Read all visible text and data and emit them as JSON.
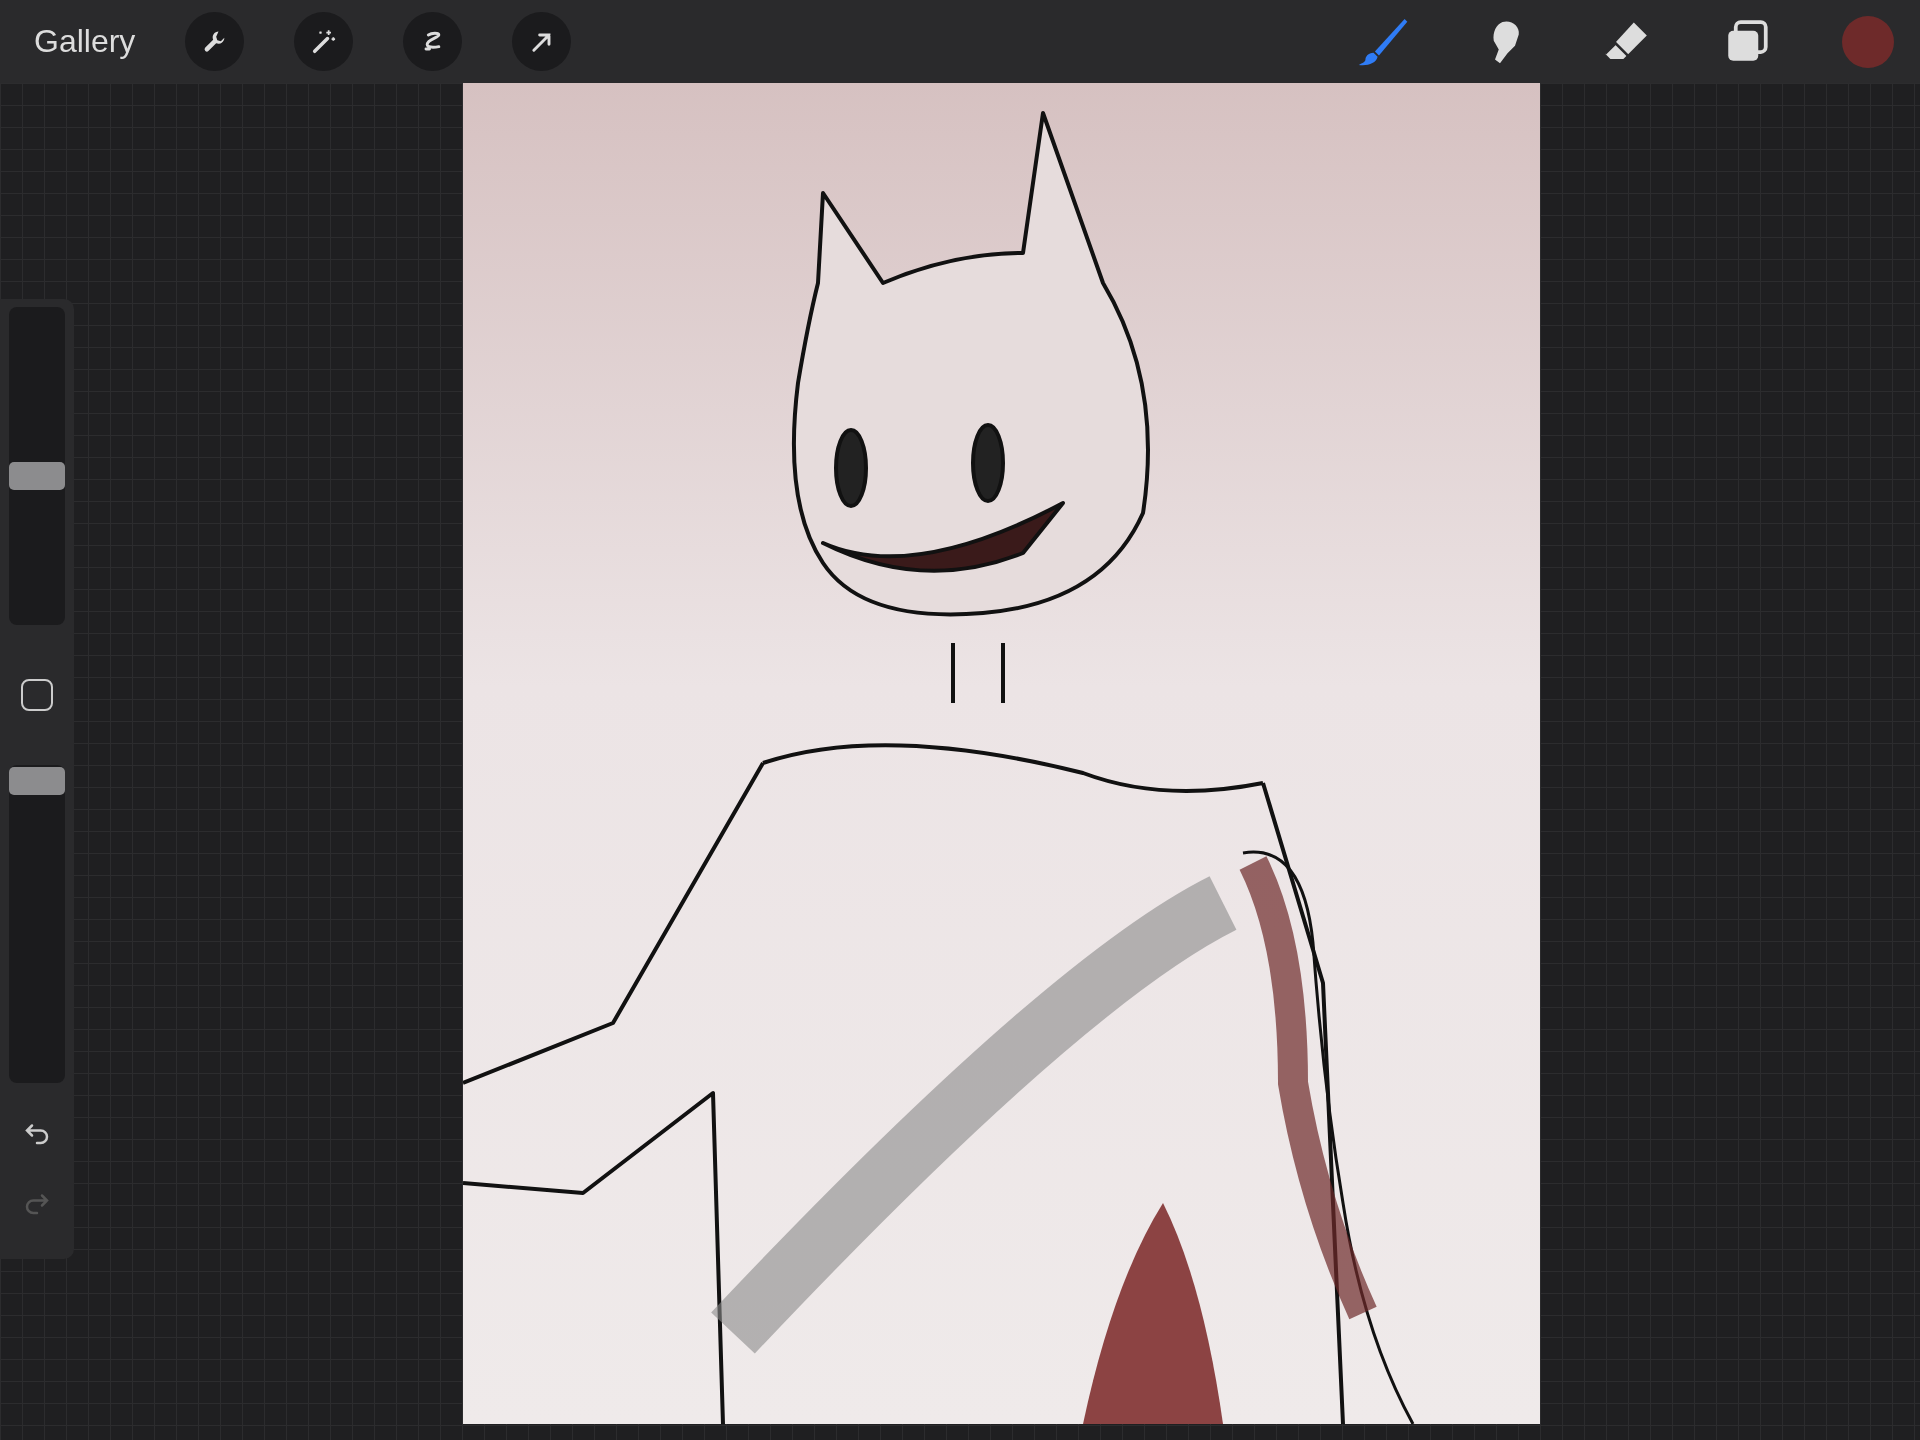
{
  "top_bar": {
    "gallery": "Gallery",
    "left_tools": [
      {
        "kind": "wrench",
        "selected": false
      },
      {
        "kind": "wand",
        "selected": false
      },
      {
        "kind": "selection",
        "selected": false
      },
      {
        "kind": "transform",
        "selected": false
      }
    ],
    "right_tools": [
      {
        "kind": "brush",
        "selected": true
      },
      {
        "kind": "smudge",
        "selected": false
      },
      {
        "kind": "eraser",
        "selected": false
      },
      {
        "kind": "layers",
        "selected": false
      }
    ],
    "color": "#6e2a2a"
  },
  "sidebar": {
    "size_slider": {
      "level": 0.47
    },
    "opacity_slider": {
      "level": 0.95
    },
    "undo": {
      "disabled": false
    },
    "redo": {
      "disabled": true
    }
  }
}
